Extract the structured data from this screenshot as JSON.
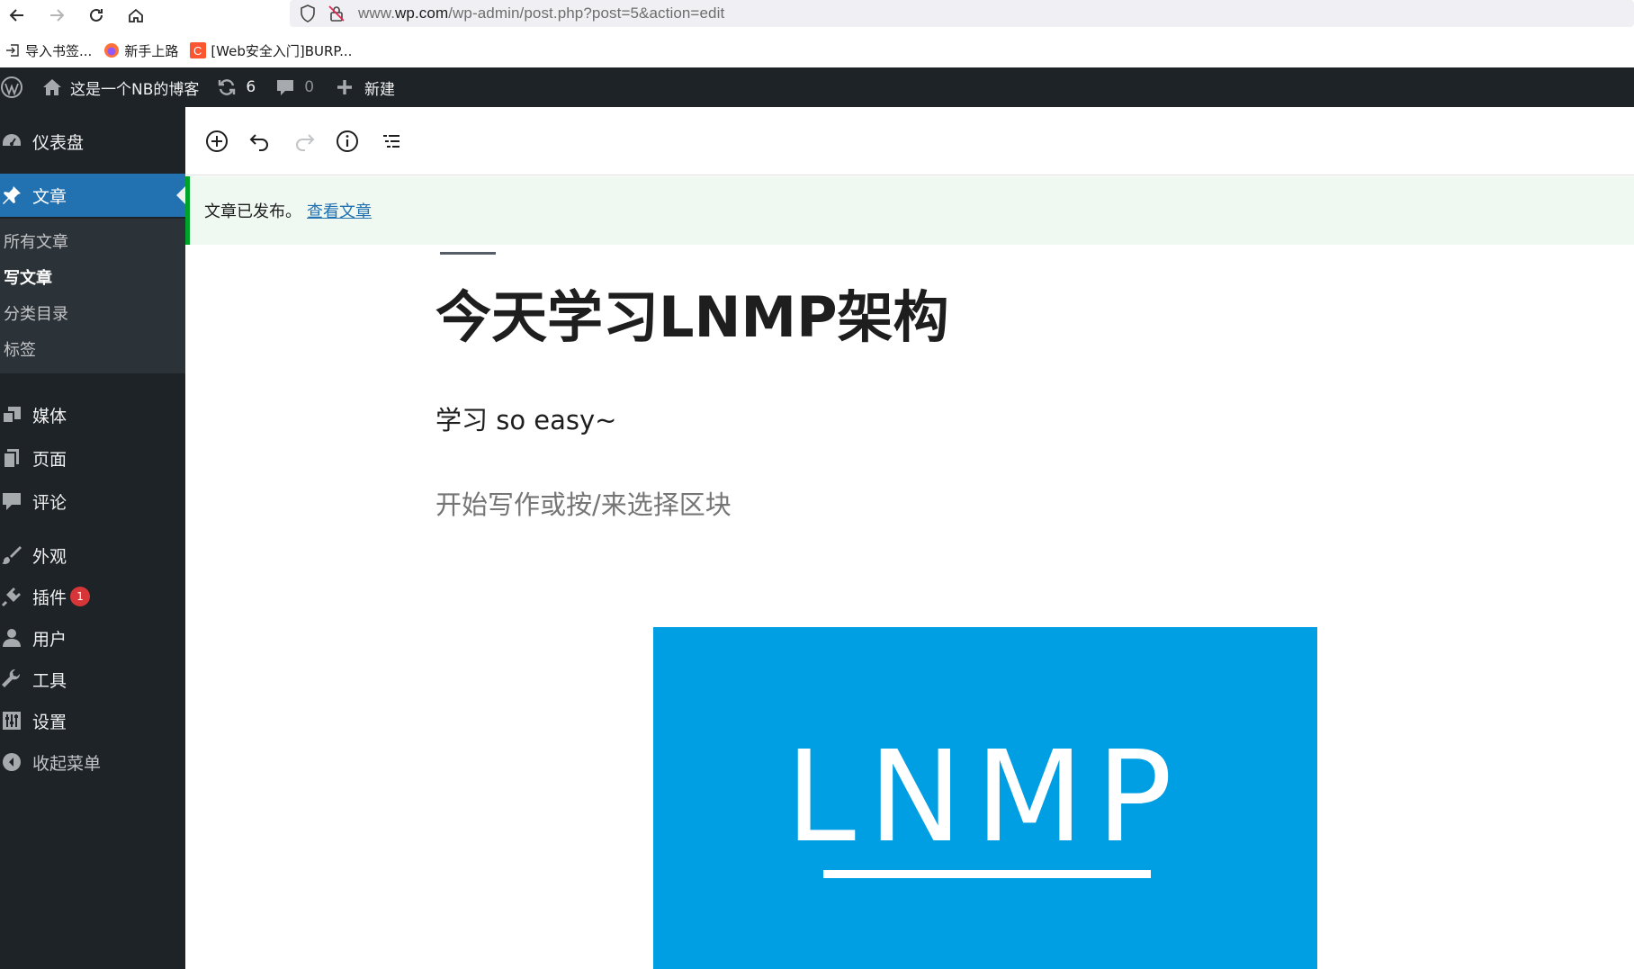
{
  "browser": {
    "url_prefix": "www.",
    "url_host": "wp.com",
    "url_path": "/wp-admin/post.php?post=5&action=edit",
    "bookmarks": [
      {
        "label": "导入书签...",
        "icon": "import-icon"
      },
      {
        "label": "新手上路",
        "icon": "firefox-icon"
      },
      {
        "label": "[Web安全入门]BURP...",
        "icon": "csdn-icon"
      }
    ]
  },
  "adminbar": {
    "site_name": "这是一个NB的博客",
    "updates_count": "6",
    "comments_count": "0",
    "new_label": "新建"
  },
  "sidebar": {
    "dashboard": "仪表盘",
    "posts": "文章",
    "posts_sub": [
      "所有文章",
      "写文章",
      "分类目录",
      "标签"
    ],
    "media": "媒体",
    "pages": "页面",
    "comments": "评论",
    "appearance": "外观",
    "plugins": "插件",
    "plugins_badge": "1",
    "users": "用户",
    "tools": "工具",
    "settings": "设置",
    "collapse": "收起菜单"
  },
  "notice": {
    "message": "文章已发布。",
    "link": "查看文章"
  },
  "editor": {
    "title": "今天学习LNMP架构",
    "paragraph": "学习 so easy~",
    "placeholder": "开始写作或按/来选择区块",
    "image_logo_text": "LNMP"
  },
  "colors": {
    "admin_dark": "#1d2327",
    "accent_blue": "#2271b1",
    "notice_green": "#00a32a",
    "logo_blue": "#009ee3"
  }
}
